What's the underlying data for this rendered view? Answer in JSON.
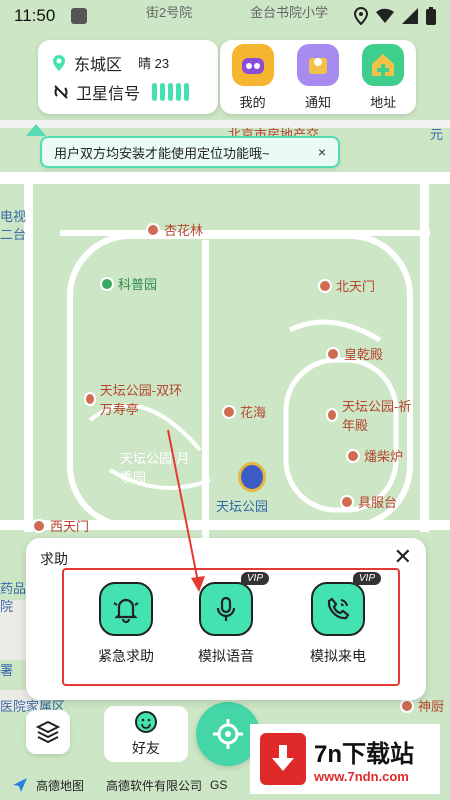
{
  "status_bar": {
    "time": "11:50"
  },
  "info_card": {
    "district": "东城区",
    "weather": "晴 23",
    "signal_label": "卫星信号"
  },
  "top_actions": [
    {
      "label": "我的",
      "icon": "profile-icon"
    },
    {
      "label": "通知",
      "icon": "notification-icon"
    },
    {
      "label": "地址",
      "icon": "address-icon"
    }
  ],
  "notice": {
    "text": "用户双方均安装才能使用定位功能哦~",
    "close": "×"
  },
  "map_labels": {
    "street_top": "街2号院",
    "school": "金台书院小学",
    "real_estate": "北京市房地产交",
    "yuan": "元",
    "tv": "电视",
    "erjia": "二台",
    "xinglin": "杏花林",
    "kepu": "科普园",
    "beitianmen": "北天门",
    "huangqian": "皇乾殿",
    "shuanghuan": "天坛公园-双环万寿亭",
    "huahai": "花海",
    "qinian": "天坛公园-祈年殿",
    "yueji": "天坛公园-月季园",
    "fanchai": "燔柴炉",
    "tiantan": "天坛公园",
    "jufu": "具服台",
    "xitianmen": "西天门",
    "yaopin": "药品",
    "yuan2": "院",
    "shenchu": "神厨",
    "family": "医院家属区",
    "er": "二",
    "shu": "署"
  },
  "help_panel": {
    "title": "求助",
    "close": "✕",
    "items": [
      {
        "label": "紧急求助",
        "icon": "bell-icon",
        "vip": ""
      },
      {
        "label": "模拟语音",
        "icon": "microphone-icon",
        "vip": "VIP"
      },
      {
        "label": "模拟来电",
        "icon": "phone-icon",
        "vip": "VIP"
      }
    ]
  },
  "bottom": {
    "friends_label": "好友"
  },
  "footer": {
    "map_brand": "高德地图",
    "company": "高德软件有限公司",
    "gs": "GS"
  },
  "brand": {
    "name": "7n下载站",
    "url": "www.7ndn.com"
  },
  "colors": {
    "accent": "#43e3b1",
    "highlight": "#e53935",
    "map_green": "#cde7c6"
  }
}
